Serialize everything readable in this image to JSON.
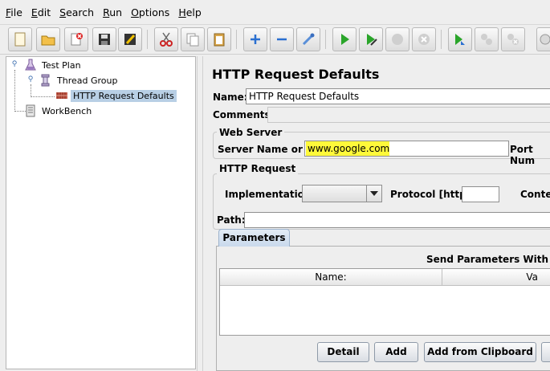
{
  "menubar": {
    "items": [
      {
        "label": "File",
        "mnemonic": "F",
        "rest": "ile"
      },
      {
        "label": "Edit",
        "mnemonic": "E",
        "rest": "dit"
      },
      {
        "label": "Search",
        "mnemonic": "S",
        "rest": "earch"
      },
      {
        "label": "Run",
        "mnemonic": "R",
        "rest": "un"
      },
      {
        "label": "Options",
        "mnemonic": "O",
        "rest": "ptions"
      },
      {
        "label": "Help",
        "mnemonic": "H",
        "rest": "elp"
      }
    ]
  },
  "toolbar": {
    "buttons": [
      "new-icon",
      "open-icon",
      "close-icon",
      "save-icon",
      "save-as-icon",
      "cut-icon",
      "copy-icon",
      "paste-icon",
      "expand-icon",
      "collapse-icon",
      "toggle-icon",
      "start-icon",
      "start-no-pauses-icon",
      "stop-icon",
      "shutdown-icon",
      "remote-start-all-icon",
      "remote-stop-all-icon",
      "remote-shutdown-all-icon",
      "clear-icon"
    ]
  },
  "tree": {
    "test_plan": "Test Plan",
    "thread_group": "Thread Group",
    "http_request_defaults": "HTTP Request Defaults",
    "workbench": "WorkBench"
  },
  "panel": {
    "title": "HTTP Request Defaults",
    "name_label": "Name:",
    "name_value": "HTTP Request Defaults",
    "comments_label": "Comments:",
    "web_server_title": "Web Server",
    "server_label": "Server Name or IP:",
    "server_value": "www.google.com",
    "port_label": "Port Num",
    "http_request_title": "HTTP Request",
    "implementation_label": "Implementation:",
    "implementation_value": "",
    "protocol_label": "Protocol [http]:",
    "protocol_value": "",
    "content_label": "Conter",
    "path_label": "Path:",
    "path_value": "",
    "parameters_tab": "Parameters",
    "send_params_label": "Send Parameters With the I",
    "table_headers": [
      "Name:",
      "Va"
    ],
    "buttons": {
      "detail": "Detail",
      "add": "Add",
      "add_from_clipboard": "Add from Clipboard"
    }
  },
  "colors": {
    "highlight": "#fff93a",
    "selection": "#b8cfe5",
    "background": "#eeeeee"
  }
}
